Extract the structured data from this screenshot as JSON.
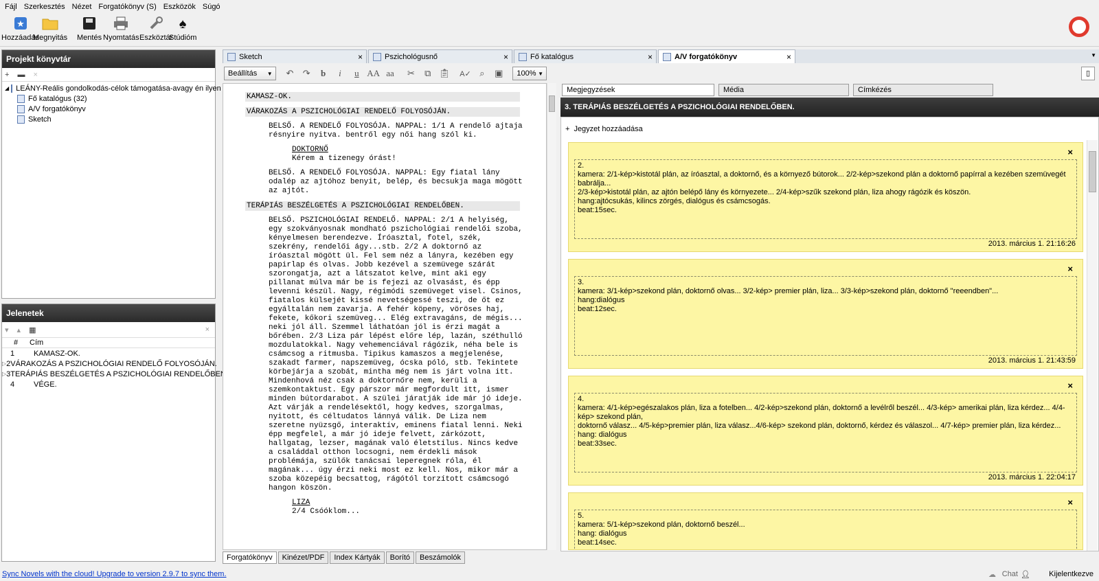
{
  "menu": [
    "Fájl",
    "Szerkesztés",
    "Nézet",
    "Forgatókönyv (S)",
    "Eszközök",
    "Súgó"
  ],
  "toolbar": {
    "new": "Hozzáadás",
    "open": "Megnyitás",
    "save": "Mentés",
    "print": "Nyomtatás",
    "tools": "Eszköztár",
    "studio": "Stúdióm"
  },
  "library": {
    "title": "Projekt könyvtár",
    "project": "LEÁNY-Reális gondolkodás-célok támogatása-avagy én ilyen k...",
    "items": [
      "Fő katalógus (32)",
      "A/V forgatókönyv",
      "Sketch"
    ]
  },
  "scenes": {
    "title": "Jelenetek",
    "col_num": "#",
    "col_title": "Cím",
    "rows": [
      {
        "n": "1",
        "t": "KAMASZ-OK."
      },
      {
        "n": "2",
        "t": "VÁRAKOZÁS A PSZICHOLÓGIAI RENDELŐ FOLYOSÓJÁN."
      },
      {
        "n": "3",
        "t": "TERÁPIÁS BESZÉLGETÉS A PSZICHOLÓGIAI RENDELŐBEN."
      },
      {
        "n": "4",
        "t": "VÉGE."
      }
    ]
  },
  "tabs": [
    "Sketch",
    "Pszichológusnő",
    "Fő katalógus",
    "A/V forgatókönyv"
  ],
  "editor": {
    "style": "Beállítás",
    "zoom": "100%"
  },
  "script": {
    "sh1": "KAMASZ-OK.",
    "sh2": "VÁRAKOZÁS A PSZICHOLÓGIAI RENDELŐ FOLYOSÓJÁN.",
    "p1": "BELSŐ. A RENDELŐ FOLYOSÓJA. NAPPAL: 1/1 A rendelő ajtaja résnyire nyitva. bentről egy női hang szól ki.",
    "c1": "DOKTORNŐ",
    "d1": "Kérem a tizenegy órást!",
    "p2": "BELSŐ. A RENDELŐ FOLYOSÓJA. NAPPAL: Egy fiatal lány odalép az ajtóhoz benyit, belép, és becsukja maga mögött az ajtót.",
    "sh3": "TERÁPIÁS BESZÉLGETÉS A PSZICHOLÓGIAI RENDELŐBEN.",
    "p3": "BELSŐ. PSZICHOLÓGIAI RENDELŐ. NAPPAL: 2/1 A helyiség, egy szokványosnak mondható pszichológiai rendelői szoba, kényelmesen berendezve. Íróasztal, fotel, szék, szekrény, rendelői ágy...stb. 2/2 A doktornő az íróasztal mögött ül. Fel sem néz a lányra, kezében egy papirlap és olvas. Jobb kezével a szemüvege szárát szorongatja, azt a látszatot kelve, mint aki egy pillanat múlva már be is fejezi az olvasást, és épp levenni készül. Nagy, régimódi szemüveget visel. Csinos, fiatalos külsejét kissé nevetségessé teszi, de őt ez egyáltalán nem zavarja. A fehér köpeny, vöröses haj, fekete, kőkori szemüveg... Elég extravagáns, de mégis... neki jól áll. Szemmel láthatóan jól is érzi magát a bőrében. 2/3 Liza pár lépést előre lép, lazán, széthulló mozdulatokkal. Nagy vehemenciával rágózik, néha bele is csámcsog a ritmusba. Tipikus kamaszos a megjelenése, szakadt farmer, napszemüveg, ócska póló, stb. Tekintete körbejárja a szobát, mintha még nem is járt volna itt. Mindenhová néz csak a doktornőre nem, kerüli a szemkontaktust. Egy párszor már megfordult itt, ismer minden bútordarabot. A szülei járatják ide már jó ideje. Azt várják a rendelésektől, hogy kedves, szorgalmas, nyitott, és céltudatos lánnyá válik. De Liza nem szeretne nyüzsgő, interaktív, eminens fiatal lenni. Neki épp megfelel, a már jó ideje felvett, zárkózott, hallgatag, lezser, magának való életstílus. Nincs kedve a családdal otthon locsogni, nem érdekli mások problémája, szülők tanácsai leperegnek róla, él magának... úgy érzi neki most ez kell. Nos, mikor már a szoba közepéig becsattog, rágótól torzított csámcsogó hangon köszön.",
    "c2": "LIZA",
    "d2": "2/4 Csóóklom..."
  },
  "bottom_tabs": [
    "Forgatókönyv",
    "Kinézet/PDF",
    "Index Kártyák",
    "Borító",
    "Beszámolók"
  ],
  "right": {
    "tabs": [
      "Megjegyzések",
      "Média",
      "Címkézés"
    ],
    "header": "3. TERÁPIÁS BESZÉLGETÉS A PSZICHOLÓGIAI RENDELŐBEN.",
    "add_note": "Jegyzet hozzáadása",
    "notes": [
      {
        "lines": [
          "2.",
          "kamera: 2/1-kép>kistotál plán, az íróasztal, a doktornő, és a környező bútorok... 2/2-kép>szekond plán a doktornő papírral a kezében szemüvegét babrálja...",
          "2/3-kép>kistotál plán, az ajtón belépő lány és környezete... 2/4-kép>szűk szekond plán, liza ahogy rágózik és köszön.",
          "hang:ajtócsukás, kilincs zörgés, dialógus és csámcsogás.",
          "beat:15sec."
        ],
        "date": "2013. március 1. 21:16:26"
      },
      {
        "lines": [
          "3.",
          "kamera: 3/1-kép>szekond plán, doktornő olvas... 3/2-kép> premier plán, liza... 3/3-kép>szekond plán, doktornő \"reeendben\"...",
          "hang:dialógus",
          "beat:12sec."
        ],
        "date": "2013. március 1. 21:43:59"
      },
      {
        "lines": [
          "4.",
          "kamera: 4/1-kép>egészalakos plán, liza a fotelben... 4/2-kép>szekond plán, doktornő a levélről beszél... 4/3-kép> amerikai plán, liza kérdez... 4/4-kép> szekond plán,",
          "doktornő válasz... 4/5-kép>premier plán, liza válasz...4/6-kép> szekond plán, doktornő, kérdez és válaszol... 4/7-kép> premier plán, liza kérdez...",
          "hang: dialógus",
          "beat:33sec."
        ],
        "date": "2013. március 1. 22:04:17"
      },
      {
        "lines": [
          "5.",
          "kamera: 5/1-kép>szekond plán, doktornő beszél...",
          "hang: dialógus",
          "beat:14sec."
        ],
        "date": ""
      }
    ]
  },
  "status": {
    "link": "Sync Novels with the cloud! Upgrade to version 2.9.7 to sync them.",
    "chat": "Chat",
    "logout": "Kijelentkezve"
  },
  "colors": {
    "note_bg": "#fdf6a4",
    "header_dark": "#2a2a2a",
    "link": "#0033cc"
  }
}
